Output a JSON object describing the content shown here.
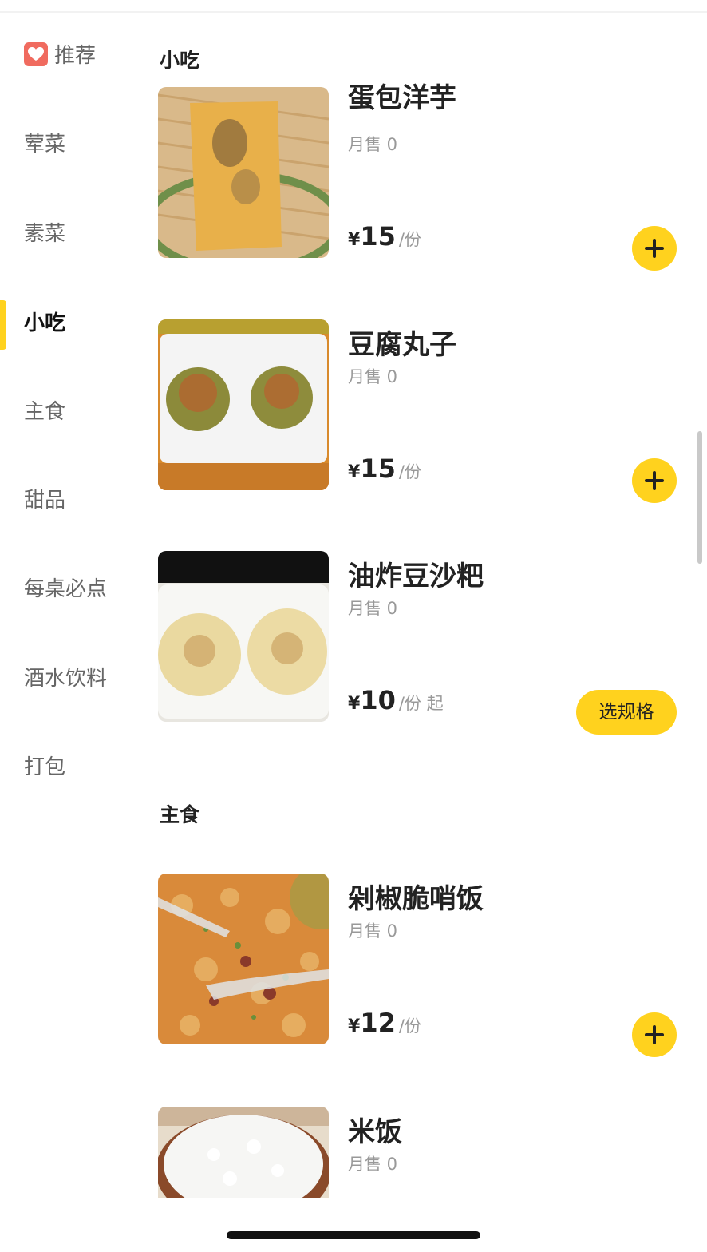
{
  "sidebar": {
    "categories": [
      {
        "label": "推荐"
      },
      {
        "label": "荤菜"
      },
      {
        "label": "素菜"
      },
      {
        "label": "小吃"
      },
      {
        "label": "主食"
      },
      {
        "label": "甜品"
      },
      {
        "label": "每桌必点"
      },
      {
        "label": "酒水饮料"
      },
      {
        "label": "打包"
      }
    ],
    "active": "小吃"
  },
  "sections": [
    {
      "title": "小吃",
      "items": [
        {
          "name": "蛋包洋芋",
          "sales": "月售 0",
          "currency": "¥",
          "price": "15",
          "unit": "/份",
          "action": "add"
        },
        {
          "name": "豆腐丸子",
          "sales": "月售 0",
          "currency": "¥",
          "price": "15",
          "unit": "/份",
          "action": "add"
        },
        {
          "name": "油炸豆沙粑",
          "sales": "月售 0",
          "currency": "¥",
          "price": "10",
          "unit": "/份 起",
          "action": "spec",
          "action_label": "选规格"
        }
      ]
    },
    {
      "title": "主食",
      "items": [
        {
          "name": "剁椒脆哨饭",
          "sales": "月售 0",
          "currency": "¥",
          "price": "12",
          "unit": "/份",
          "action": "add"
        },
        {
          "name": "米饭",
          "sales": "月售 0"
        }
      ]
    }
  ],
  "colors": {
    "accent": "#ffd21e",
    "recommend_icon": "#f06b5f",
    "muted_text": "#999999"
  }
}
